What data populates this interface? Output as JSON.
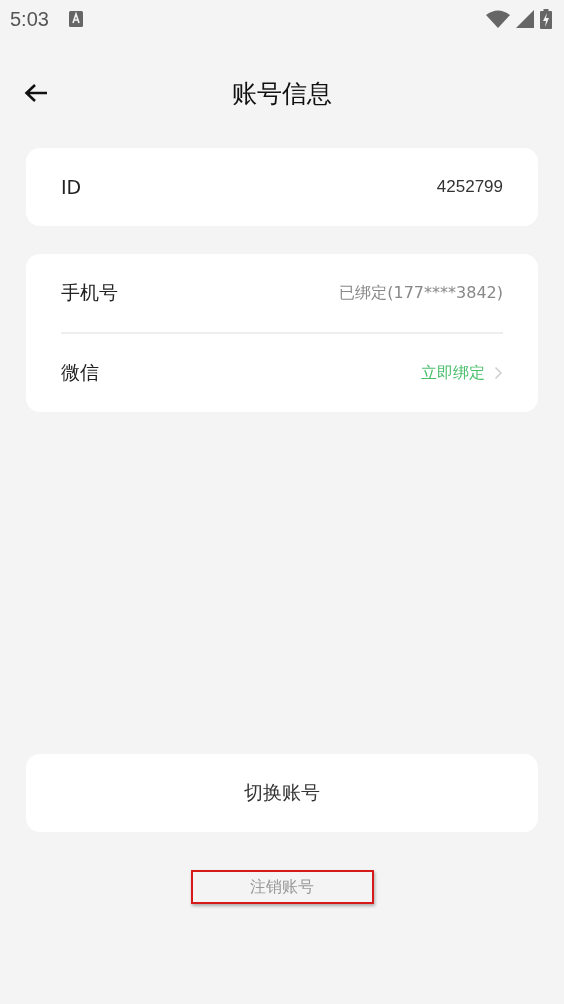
{
  "status_bar": {
    "time": "5:03"
  },
  "header": {
    "title": "账号信息"
  },
  "groups": [
    {
      "rows": [
        {
          "label": "ID",
          "value": "4252799",
          "kind": "id"
        }
      ]
    },
    {
      "rows": [
        {
          "label": "手机号",
          "value": "已绑定(177****3842)",
          "kind": "plain"
        },
        {
          "label": "微信",
          "value": "立即绑定",
          "kind": "link"
        }
      ]
    }
  ],
  "switch_button": {
    "label": "切换账号"
  },
  "delete_account": {
    "label": "注销账号",
    "highlighted": true
  }
}
